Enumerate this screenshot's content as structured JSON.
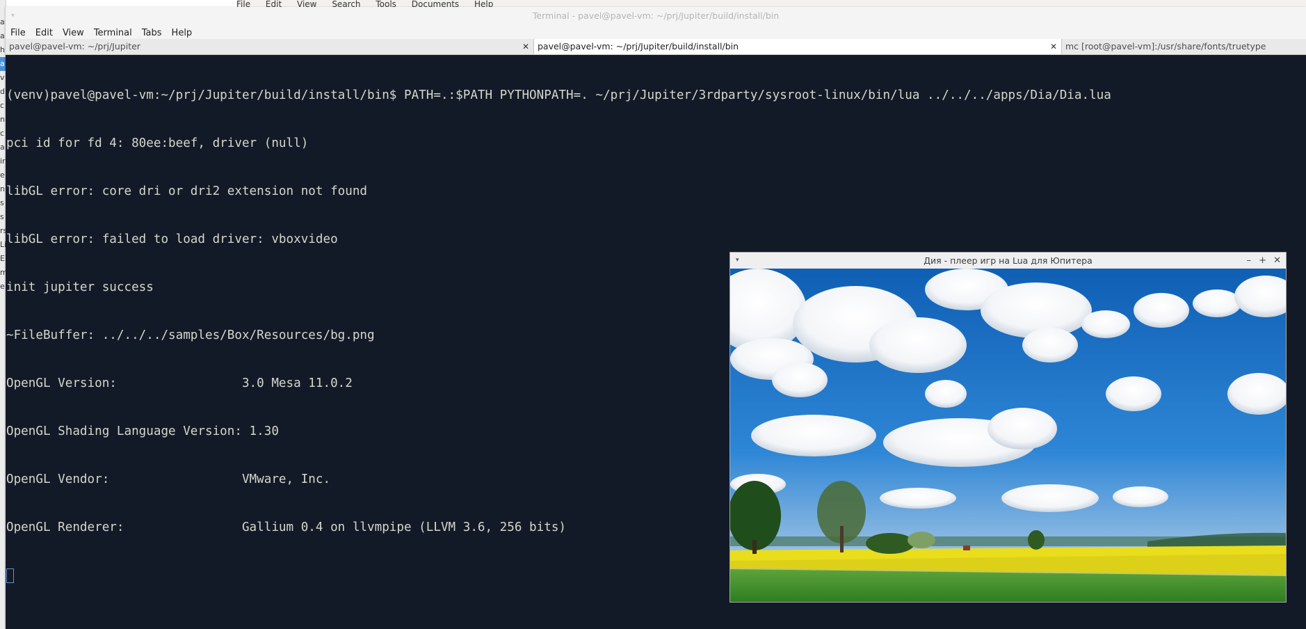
{
  "background_window": {
    "menu": [
      "File",
      "Edit",
      "View",
      "Search",
      "Tools",
      "Documents",
      "Help"
    ],
    "left_strip_chars": [
      "a",
      "a",
      "h",
      "a",
      "v",
      "d",
      "c",
      "n",
      "c",
      "a",
      "ir",
      "e",
      "n",
      "s",
      "s",
      "rs",
      "Lis",
      "E",
      "m",
      "e"
    ]
  },
  "terminal": {
    "title": "Terminal - pavel@pavel-vm: ~/prj/Jupiter/build/install/bin",
    "window_menu_icon": "▾",
    "menu": [
      "File",
      "Edit",
      "View",
      "Terminal",
      "Tabs",
      "Help"
    ],
    "tabs": [
      {
        "label": "pavel@pavel-vm: ~/prj/Jupiter",
        "close": "✕"
      },
      {
        "label": "pavel@pavel-vm: ~/prj/Jupiter/build/install/bin",
        "close": "✕"
      },
      {
        "label": "mc [root@pavel-vm]:/usr/share/fonts/truetype"
      }
    ],
    "lines": [
      "(venv)pavel@pavel-vm:~/prj/Jupiter/build/install/bin$ PATH=.:$PATH PYTHONPATH=. ~/prj/Jupiter/3rdparty/sysroot-linux/bin/lua ../../../apps/Dia/Dia.lua",
      "pci id for fd 4: 80ee:beef, driver (null)",
      "libGL error: core dri or dri2 extension not found",
      "libGL error: failed to load driver: vboxvideo",
      "init jupiter success",
      "~FileBuffer: ../../../samples/Box/Resources/bg.png",
      "OpenGL Version:                 3.0 Mesa 11.0.2",
      "OpenGL Shading Language Version: 1.30",
      "OpenGL Vendor:                  VMware, Inc.",
      "OpenGL Renderer:                Gallium 0.4 on llvmpipe (LLVM 3.6, 256 bits)"
    ]
  },
  "game_window": {
    "title": "Дия - плеер игр на Lua для Юпитера",
    "menu_arrow": "▾",
    "minimize": "–",
    "maximize": "+",
    "close": "✕",
    "scene": "sky-clouds-rapeseed-field-background"
  },
  "colors": {
    "terminal_bg": "#131a27",
    "terminal_fg": "#d3d7cf",
    "sky": "#1d6fc4",
    "field_yellow": "#e9dd1c",
    "grass": "#3f8f2c"
  }
}
